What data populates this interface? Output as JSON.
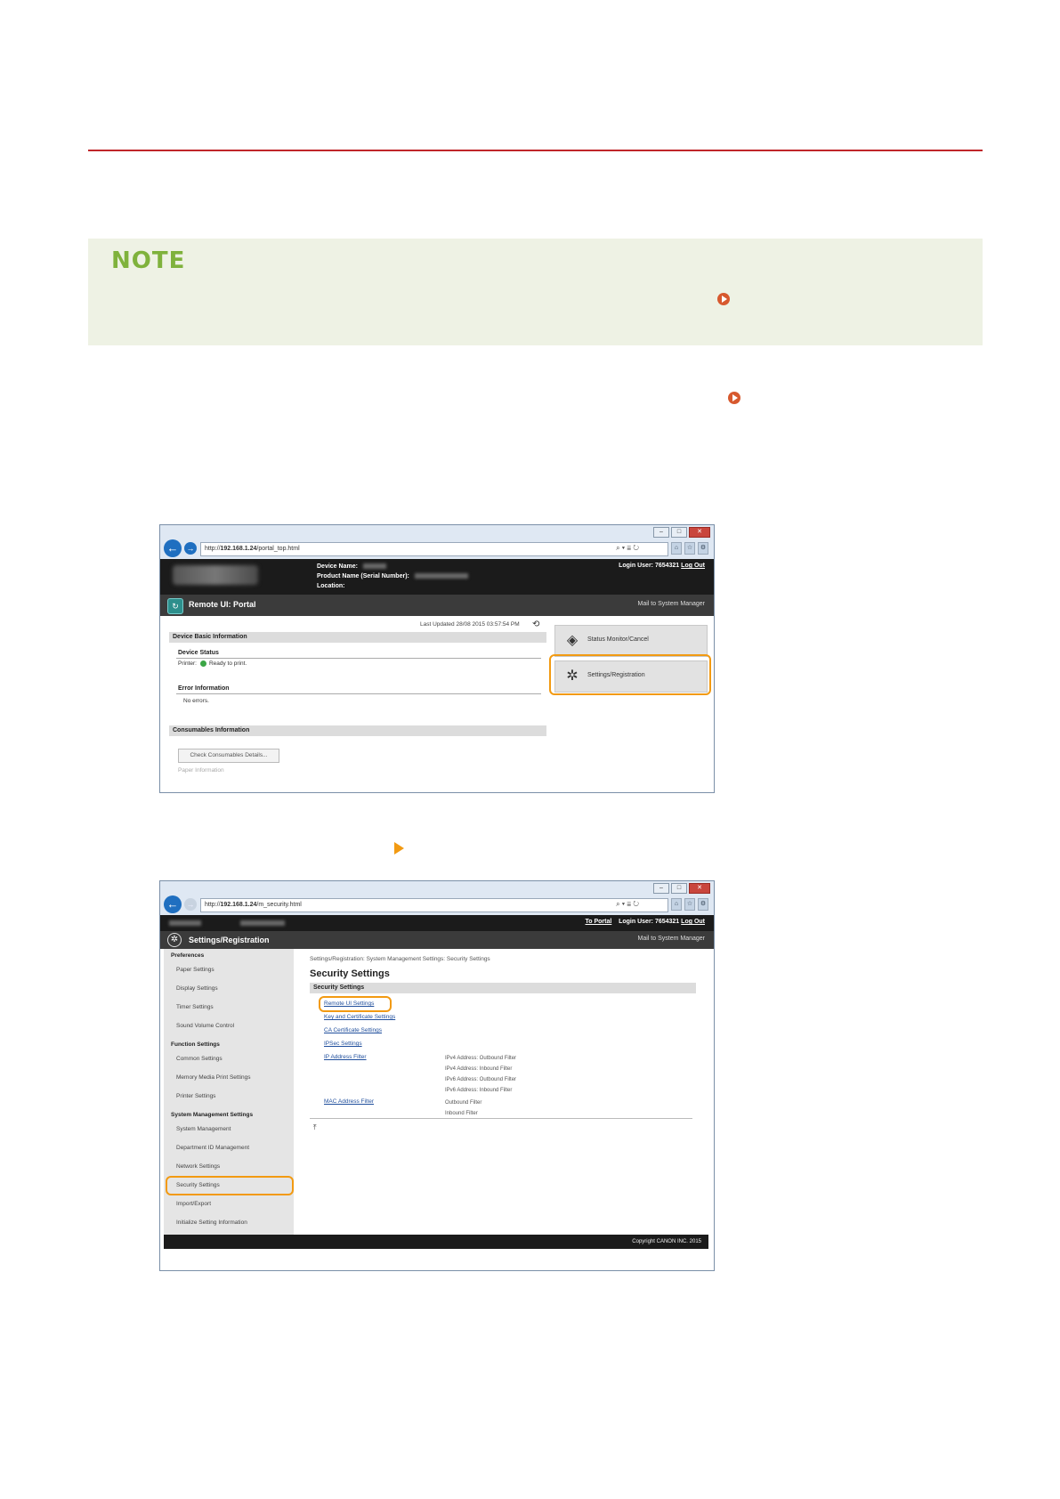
{
  "note": {
    "title": "NOTE"
  },
  "window1": {
    "url_prefix": "http://",
    "url_host": "192.168.1.24",
    "url_path": "/portal_top.html",
    "header": {
      "device_name_label": "Device Name:",
      "product_name_label": "Product Name (Serial Number):",
      "location_label": "Location:",
      "login_user_label": "Login User:",
      "login_user_value": "7654321",
      "logout": "Log Out"
    },
    "title": "Remote UI: Portal",
    "mail": "Mail to System Manager",
    "last_updated": "Last Updated 28/08 2015 03:57:54 PM",
    "device_basic_info": "Device Basic Information",
    "device_status": "Device Status",
    "printer_label": "Printer:",
    "printer_status": "Ready to print.",
    "error_information": "Error Information",
    "no_errors": "No errors.",
    "consumables_information": "Consumables Information",
    "check_consumables": "Check Consumables Details...",
    "paper_information": "Paper Information",
    "status_monitor": "Status Monitor/Cancel",
    "settings_registration": "Settings/Registration"
  },
  "window2": {
    "url_prefix": "http://",
    "url_host": "192.168.1.24",
    "url_path": "/m_security.html",
    "header": {
      "to_portal": "To Portal",
      "login_user_label": "Login User:",
      "login_user_value": "7654321",
      "logout": "Log Out"
    },
    "title": "Settings/Registration",
    "mail": "Mail to System Manager",
    "sidebar": {
      "preferences": "Preferences",
      "paper_settings": "Paper Settings",
      "display_settings": "Display Settings",
      "timer_settings": "Timer Settings",
      "sound_volume": "Sound Volume Control",
      "function_settings": "Function Settings",
      "common_settings": "Common Settings",
      "memory_media": "Memory Media Print Settings",
      "printer_settings": "Printer Settings",
      "system_mgmt_settings": "System Management Settings",
      "system_management": "System Management",
      "dept_id": "Department ID Management",
      "network_settings": "Network Settings",
      "security_settings": "Security Settings",
      "import_export": "Import/Export",
      "initialize": "Initialize Setting Information"
    },
    "breadcrumb": "Settings/Registration: System Management Settings: Security Settings",
    "page_title": "Security Settings",
    "section": "Security Settings",
    "links": {
      "remote_ui": "Remote UI Settings",
      "key_cert": "Key and Certificate Settings",
      "ca_cert": "CA Certificate Settings",
      "ipsec": "IPSec Settings",
      "ip_filter": "IP Address Filter",
      "mac_filter": "MAC Address Filter"
    },
    "ip_filters": {
      "ipv4_out": "IPv4 Address: Outbound Filter",
      "ipv4_in": "IPv4 Address: Inbound Filter",
      "ipv6_out": "IPv6 Address: Outbound Filter",
      "ipv6_in": "IPv6 Address: Inbound Filter"
    },
    "mac_filters": {
      "outbound": "Outbound Filter",
      "inbound": "Inbound Filter"
    },
    "copyright": "Copyright CANON INC. 2015"
  },
  "colors": {
    "rule": "#c0262a",
    "note_bg": "#eef2e4",
    "note_title": "#7fb23c",
    "highlight": "#f29a12",
    "link": "#1f4e9c"
  }
}
